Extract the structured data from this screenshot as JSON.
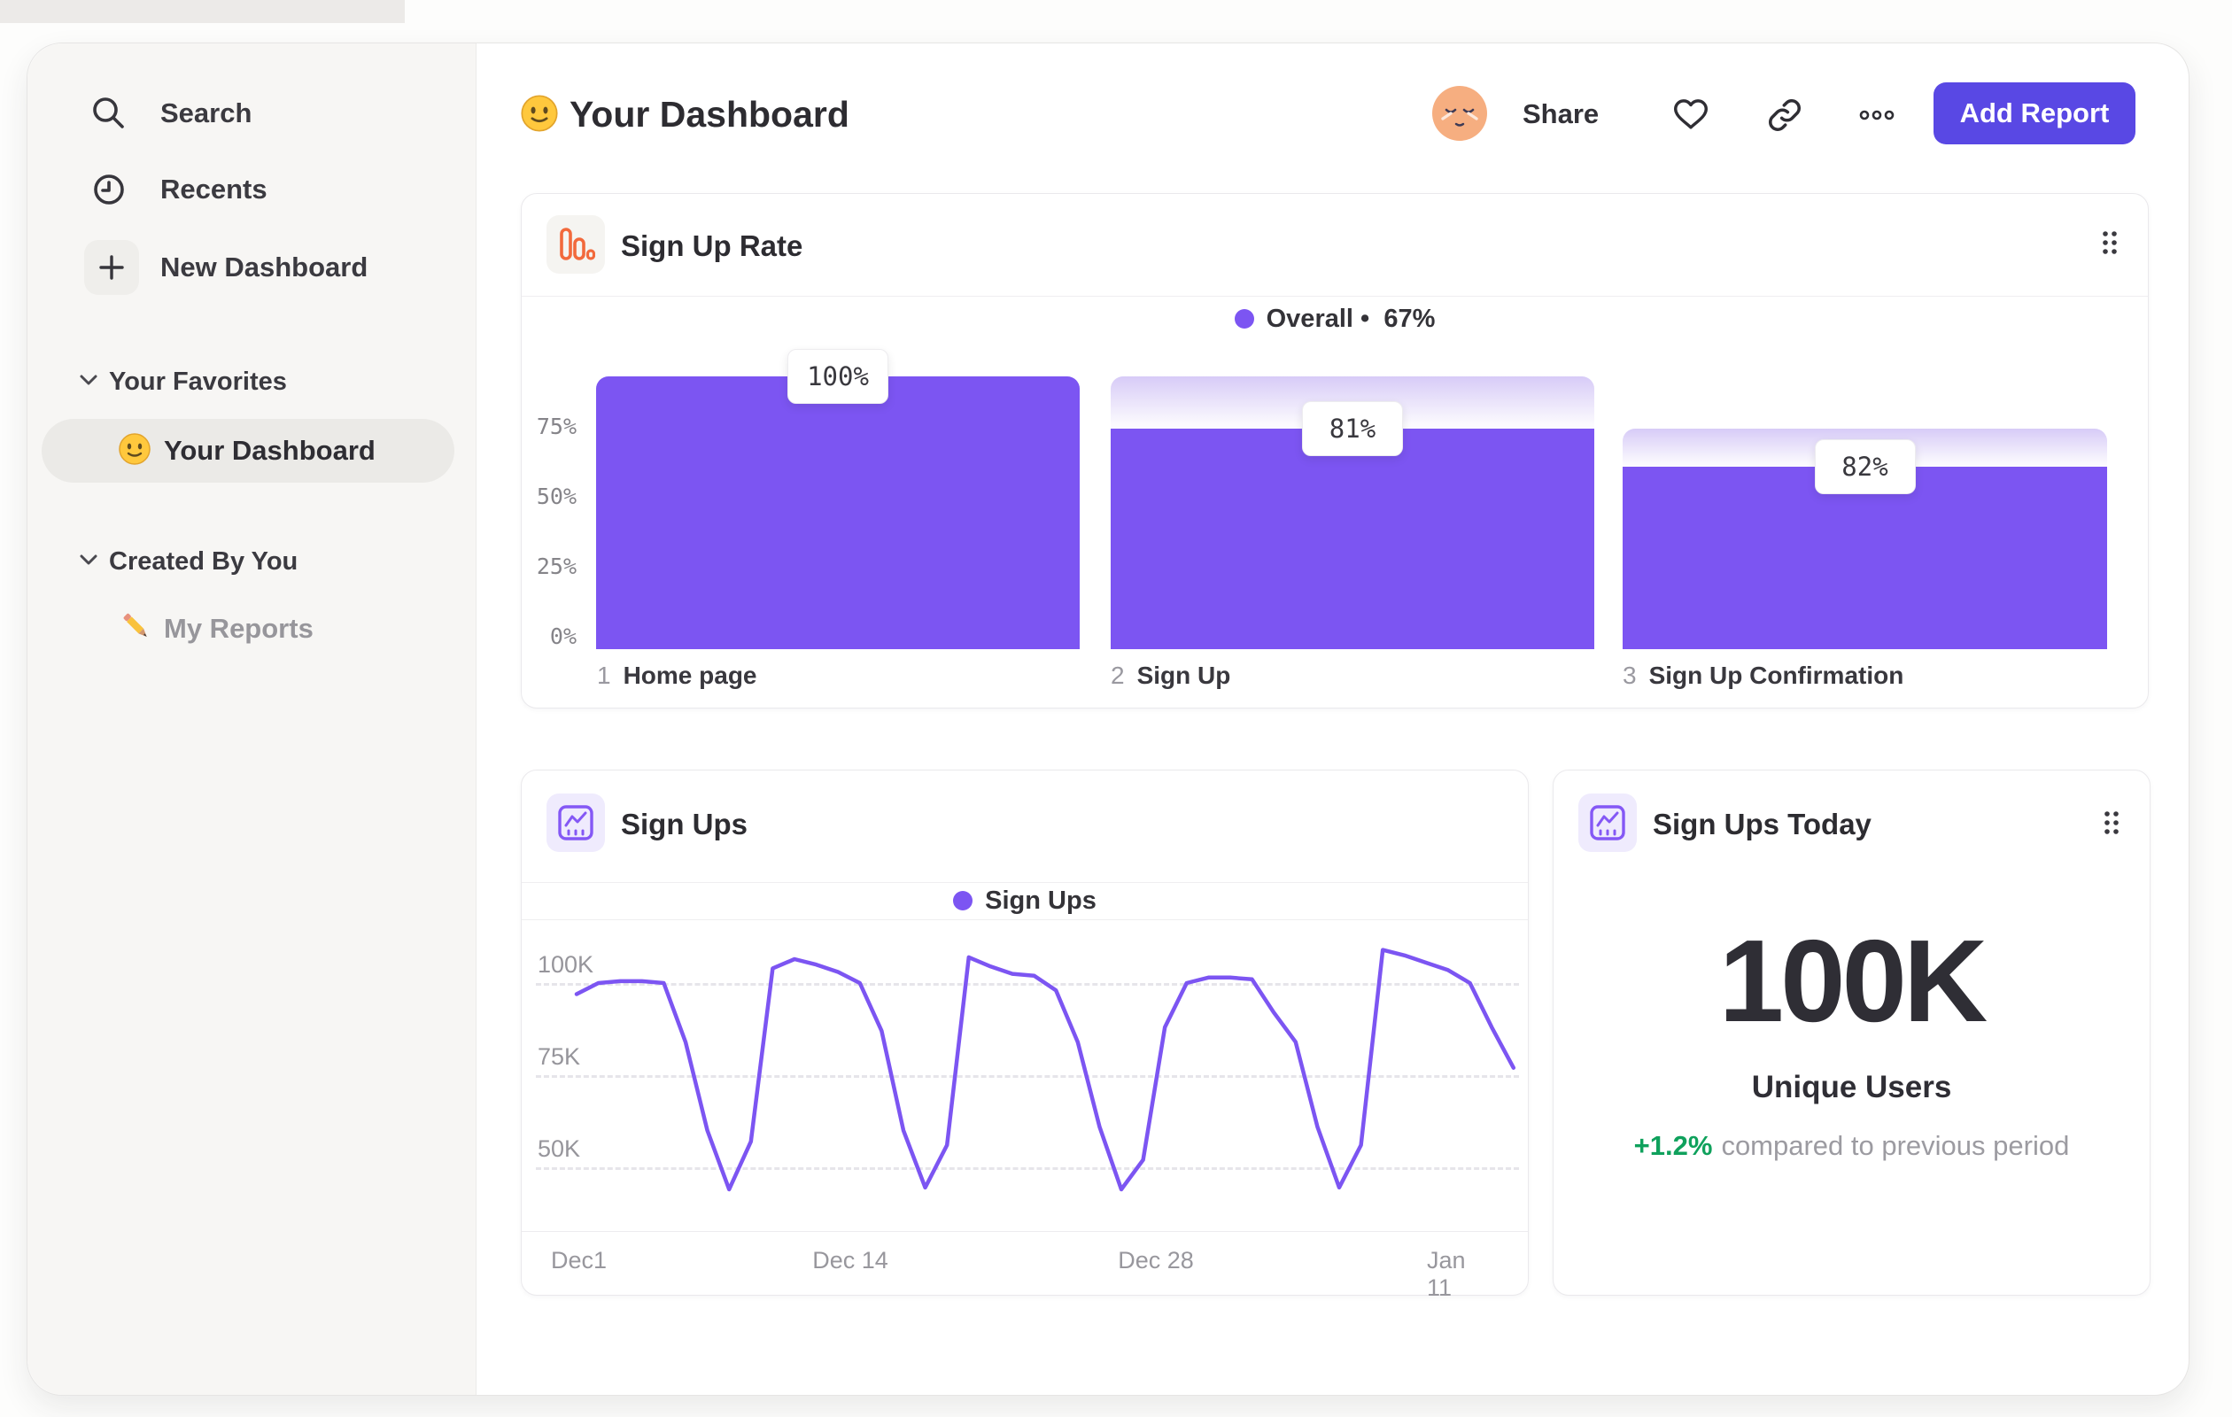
{
  "sidebar": {
    "nav": [
      {
        "label": "Search"
      },
      {
        "label": "Recents"
      },
      {
        "label": "New Dashboard"
      }
    ],
    "sections": [
      {
        "title": "Your Favorites",
        "items": [
          {
            "label": "Your Dashboard"
          }
        ]
      },
      {
        "title": "Created By You",
        "items": [
          {
            "label": "My Reports"
          }
        ]
      }
    ]
  },
  "header": {
    "title": "Your Dashboard",
    "share": "Share",
    "add_report": "Add Report"
  },
  "funnel_card": {
    "title": "Sign Up Rate",
    "legend_label": "Overall",
    "legend_separator": "•",
    "legend_value": "67%",
    "y_ticks": [
      "75%",
      "50%",
      "25%",
      "0%"
    ],
    "steps": [
      {
        "num": "1",
        "label": "Home page",
        "value": "100%"
      },
      {
        "num": "2",
        "label": "Sign Up",
        "value": "81%"
      },
      {
        "num": "3",
        "label": "Sign Up Confirmation",
        "value": "82%"
      }
    ]
  },
  "signups_card": {
    "title": "Sign Ups",
    "legend_label": "Sign Ups",
    "y_ticks": [
      "100K",
      "75K",
      "50K"
    ],
    "x_ticks": [
      "Dec1",
      "Dec 14",
      "Dec 28",
      "Jan 11"
    ]
  },
  "today_card": {
    "title": "Sign Ups Today",
    "value": "100K",
    "metric": "Unique Users",
    "delta": "+1.2%",
    "delta_caption": "compared to previous period"
  },
  "colors": {
    "accent_purple": "#7C55F2",
    "gradient_light_purple": "#D7CBF7",
    "button_indigo": "#5948E4",
    "icon_orange": "#F2693C",
    "positive_green": "#0FA15C"
  },
  "chart_data": [
    {
      "type": "bar",
      "subtype": "funnel",
      "title": "Sign Up Rate",
      "categories": [
        "1 Home page",
        "2 Sign Up",
        "3 Sign Up Confirmation"
      ],
      "values_pct_of_previous": [
        100,
        81,
        82
      ],
      "values_pct_overall": [
        100,
        81,
        67
      ],
      "series_name": "Overall",
      "overall_conversion": "67%",
      "ylim": [
        0,
        100
      ],
      "y_tick_labels": [
        "0%",
        "25%",
        "50%",
        "75%"
      ],
      "grid": false,
      "legend_position": "top-center"
    },
    {
      "type": "line",
      "title": "Sign Ups",
      "x_start_date": "Dec 1",
      "x_tick_labels": [
        "Dec1",
        "Dec 14",
        "Dec 28",
        "Jan 11"
      ],
      "x_tick_day_index": [
        0,
        13,
        27,
        41
      ],
      "unit": "K",
      "y_ticks": [
        100,
        75,
        50
      ],
      "ylim": [
        31,
        115
      ],
      "grid": "dashed-horizontal",
      "legend_position": "top-center",
      "series": [
        {
          "name": "Sign Ups",
          "values": [
            97,
            100,
            100.5,
            100.5,
            100,
            84,
            60,
            44,
            57,
            104,
            106.5,
            105,
            103,
            100,
            87,
            60,
            44.5,
            56,
            107,
            104.5,
            102.5,
            102,
            98,
            84,
            61,
            44,
            52,
            88,
            100,
            101.5,
            101.5,
            101,
            92,
            84,
            61,
            44.5,
            56,
            109,
            107.5,
            105.5,
            103.5,
            100,
            88,
            77
          ]
        }
      ]
    }
  ]
}
